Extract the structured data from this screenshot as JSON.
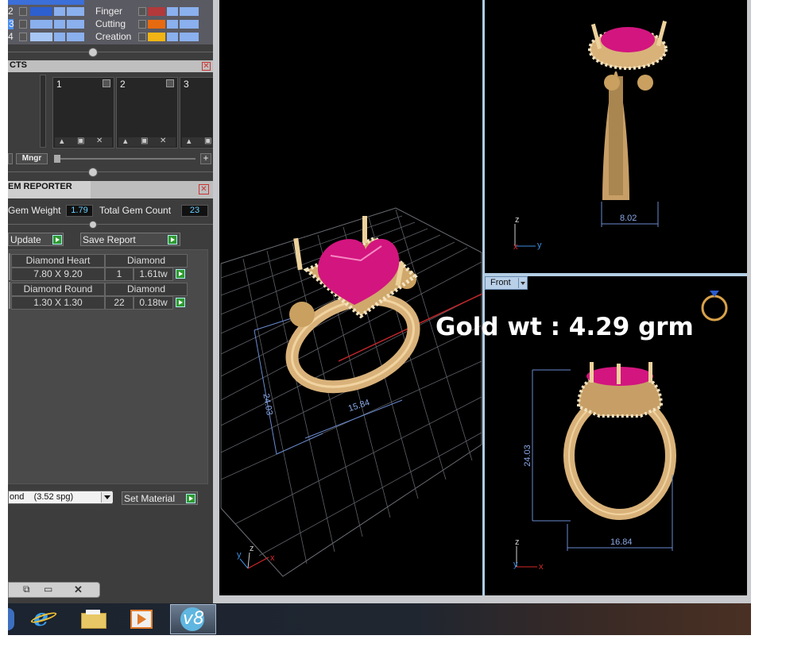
{
  "layers": [
    {
      "num": "2",
      "name": "Finger",
      "color": "#b23a3a"
    },
    {
      "num": "3",
      "name": "Cutting",
      "color": "#e66a10"
    },
    {
      "num": "4",
      "name": "Creation",
      "color": "#f1b414"
    }
  ],
  "objects": {
    "title": "CTS",
    "slots": [
      "1",
      "2",
      "3"
    ],
    "mngr_label": "Mngr"
  },
  "gem_reporter": {
    "title": "EM REPORTER",
    "gem_weight_label": "Gem Weight",
    "gem_weight_value": "1.79",
    "total_count_label": "Total Gem Count",
    "total_count_value": "23",
    "update_label": "Update",
    "save_report_label": "Save Report",
    "rows": [
      {
        "name": "Diamond Heart",
        "type": "Diamond",
        "size": "7.80 X 9.20",
        "count": "1",
        "weight": "1.61tw"
      },
      {
        "name": "Diamond Round",
        "type": "Diamond",
        "size": "1.30 X 1.30",
        "count": "22",
        "weight": "0.18tw"
      }
    ],
    "material_value": "ond    (3.52 spg)",
    "set_material_label": "Set Material"
  },
  "viewports": {
    "perspective_dims": {
      "height": "24.03",
      "width": "15.84"
    },
    "side_dims": {
      "width": "8.02"
    },
    "front_label": "Front",
    "front_dims": {
      "height": "24.03",
      "width": "16.84"
    },
    "axes": {
      "x": "x",
      "y": "y",
      "z": "z"
    }
  },
  "overlay_text": "Gold wt : 4.29 grm",
  "colors": {
    "gem": "#d3157f",
    "gold": "#d9b27a",
    "axis_y": "#3d8fe0",
    "axis_x": "#d8282a",
    "axis_z": "#cfcfcf"
  },
  "taskbar": {
    "apps": [
      "internet-explorer",
      "file-explorer",
      "media-player",
      "v8-app"
    ]
  }
}
